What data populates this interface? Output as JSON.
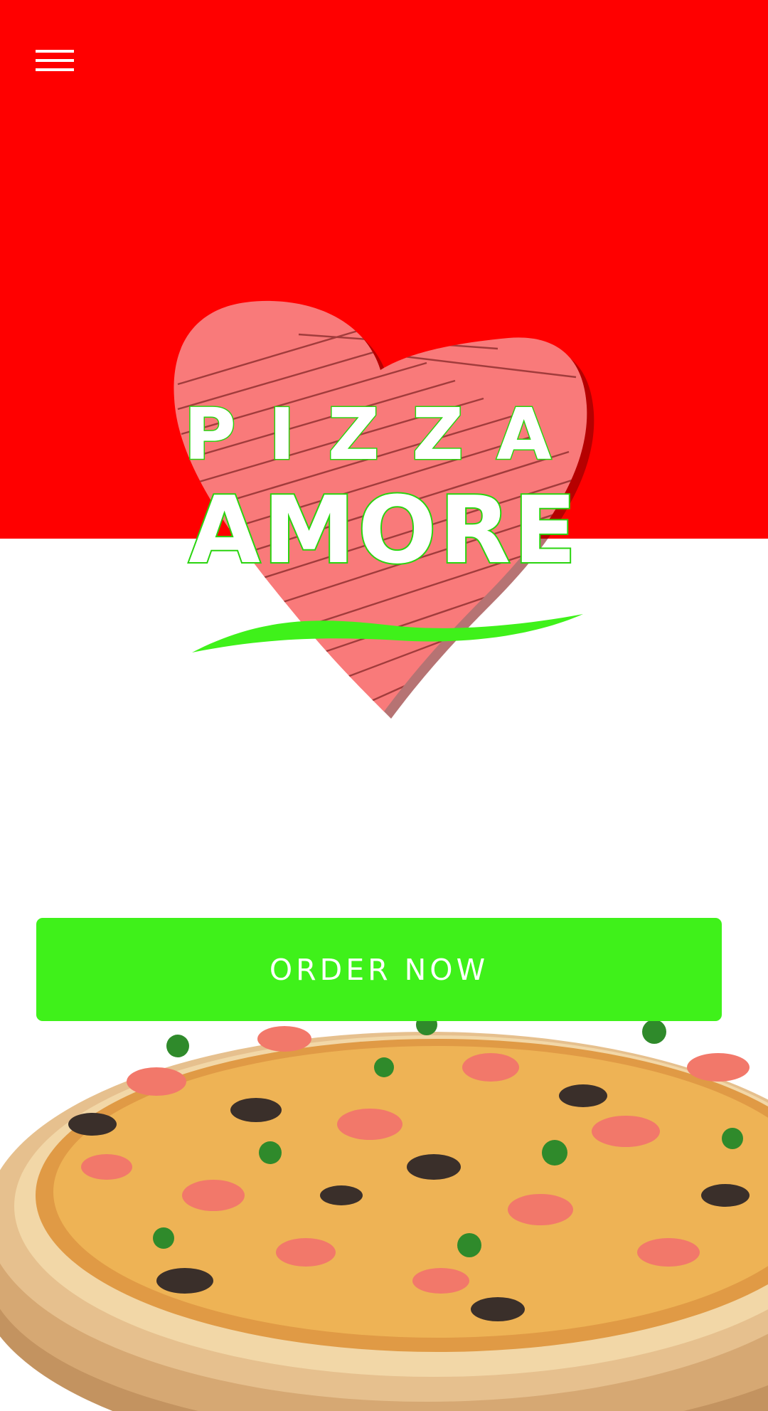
{
  "app": {
    "brand_line1": "PIZZA",
    "brand_line2": "AMORE"
  },
  "toolbar": {
    "menu_icon": "hamburger-menu-icon"
  },
  "main": {
    "order_button_label": "ORDER NOW",
    "hero_image": "seafood-pizza"
  },
  "colors": {
    "top_band": "#ff0000",
    "accent_green": "#3ff11a",
    "heart_pink": "#f97a7a",
    "background": "#ffffff"
  }
}
